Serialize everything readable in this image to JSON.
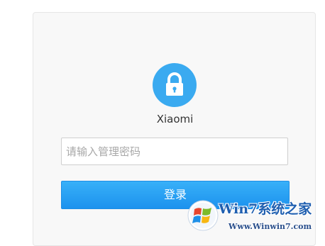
{
  "login": {
    "router_name": "Xiaomi",
    "password_placeholder": "请输入管理密码",
    "login_label": "登录",
    "lock_icon": "lock-icon"
  },
  "watermark": {
    "line1": "Win7系统之家",
    "line2": "Www.Winwin7.com",
    "logo_icon": "windows-logo-icon"
  },
  "colors": {
    "accent": "#3aaaf0",
    "button": "#1c92ee",
    "panel_background": "#f8f8f8"
  }
}
